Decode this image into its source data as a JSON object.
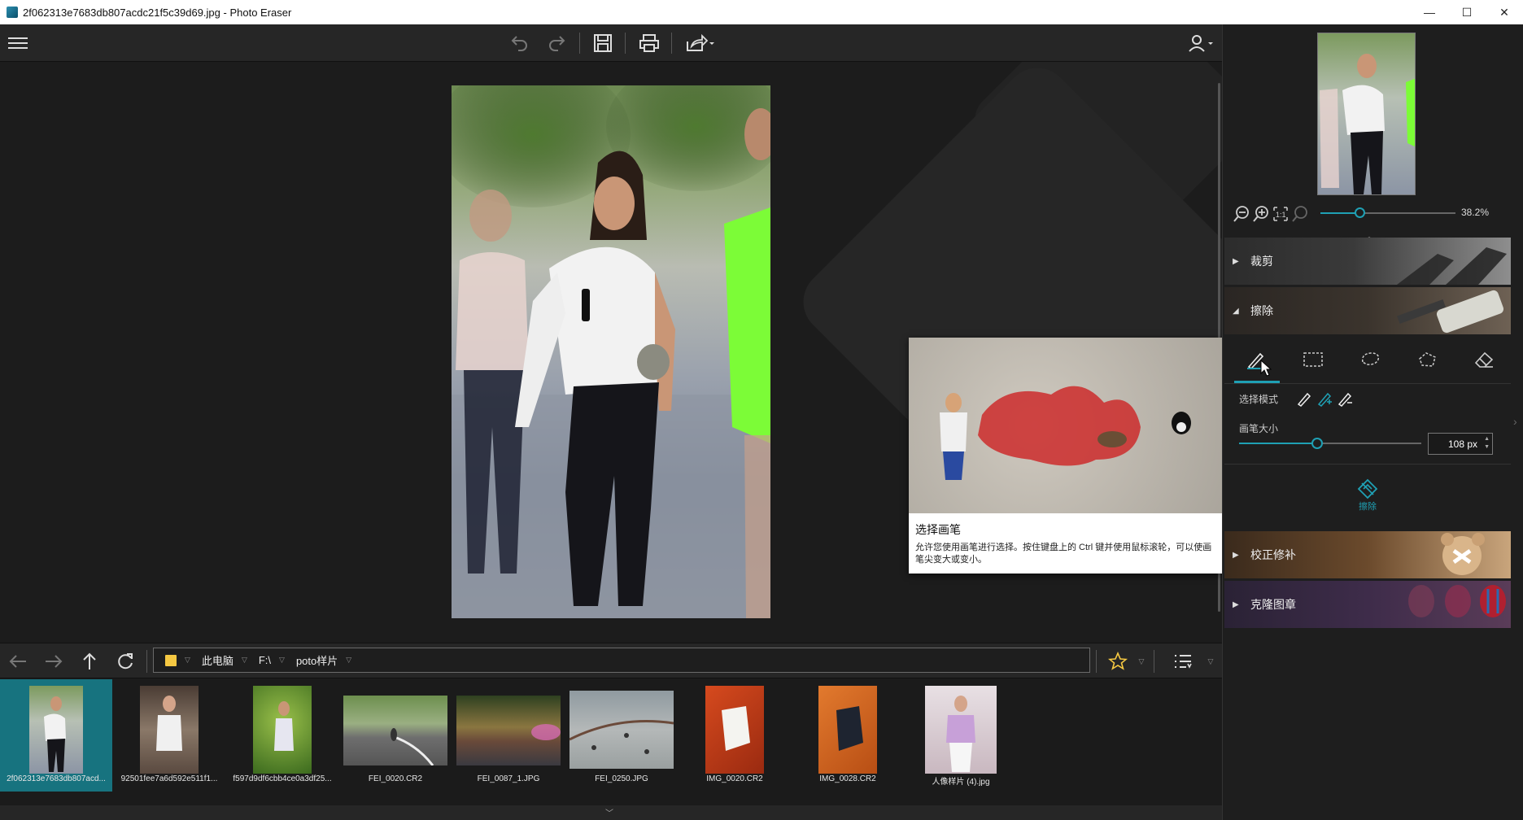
{
  "window": {
    "title": "2f062313e7683db807acdc21f5c39d69.jpg - Photo Eraser",
    "controls": {
      "minimize": "—",
      "maximize": "☐",
      "close": "✕"
    }
  },
  "toolbar": {
    "icons": [
      "menu-icon",
      "undo-icon",
      "redo-icon",
      "save-icon",
      "print-icon",
      "share-icon",
      "user-icon"
    ]
  },
  "tooltip": {
    "title": "选择画笔",
    "text": "允许您使用画笔进行选择。按住键盘上的 Ctrl 键并使用鼠标滚轮，可以使画笔尖变大或变小。"
  },
  "right_panel": {
    "zoom_value": "38.2%",
    "zoom_level": 0.29,
    "sections": {
      "crop": "裁剪",
      "erase": "擦除",
      "repair": "校正修补",
      "clone": "克隆图章"
    },
    "selection_mode_label": "选择模式",
    "brush_size_label": "画笔大小",
    "brush_size_value": "108 px",
    "brush_size_level": 0.42,
    "erase_button": "擦除",
    "accent_color": "#1fa0b4"
  },
  "navigation": {
    "path": {
      "computer": "此电脑",
      "drive": "F:\\",
      "folder": "poto样片"
    }
  },
  "filmstrip": {
    "items": [
      {
        "name": "2f062313e7683db807acd...",
        "selected": true
      },
      {
        "name": "92501fee7a6d592e511f1...",
        "selected": false
      },
      {
        "name": "f597d9df6cbb4ce0a3df25...",
        "selected": false
      },
      {
        "name": "FEI_0020.CR2",
        "selected": false
      },
      {
        "name": "FEI_0087_1.JPG",
        "selected": false
      },
      {
        "name": "FEI_0250.JPG",
        "selected": false
      },
      {
        "name": "IMG_0020.CR2",
        "selected": false
      },
      {
        "name": "IMG_0028.CR2",
        "selected": false
      },
      {
        "name": "人像样片 (4).jpg",
        "selected": false
      }
    ]
  }
}
